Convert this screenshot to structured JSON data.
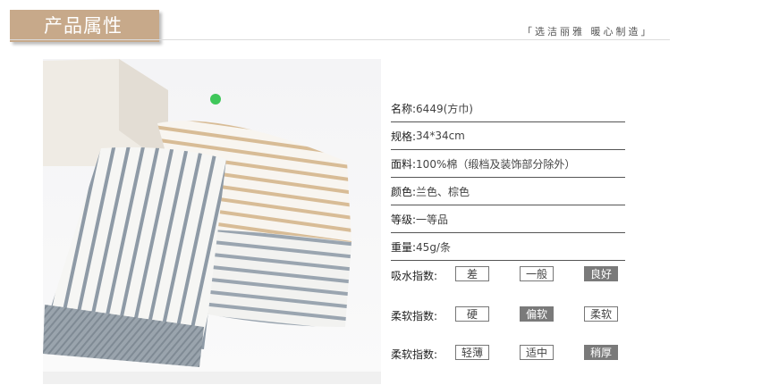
{
  "header": {
    "title": "产品属性",
    "slogan": "「选洁丽雅  暖心制造」"
  },
  "specs": [
    {
      "label": "名称:",
      "value": "6449(方巾)"
    },
    {
      "label": "规格:",
      "value": "34*34cm"
    },
    {
      "label": "面料:",
      "value": "100%棉（缎档及装饰部分除外）"
    },
    {
      "label": "颜色:",
      "value": "兰色、棕色"
    },
    {
      "label": "等级:",
      "value": "一等品"
    },
    {
      "label": "重量:",
      "value": "45g/条"
    }
  ],
  "indices": [
    {
      "label": "吸水指数:",
      "options": [
        "差",
        "一般",
        "良好"
      ],
      "selected": "良好"
    },
    {
      "label": "柔软指数:",
      "options": [
        "硬",
        "偏软",
        "柔软"
      ],
      "selected": "偏软"
    },
    {
      "label": "柔软指数:",
      "options": [
        "轻薄",
        "适中",
        "稍厚"
      ],
      "selected": "稍厚"
    }
  ],
  "colors": {
    "title_tab": "#c7a98a",
    "chip_active": "#7a7a7a",
    "towel_blue_stripe": "#8e9aa6",
    "towel_tan_stripe": "#d2b48c"
  }
}
